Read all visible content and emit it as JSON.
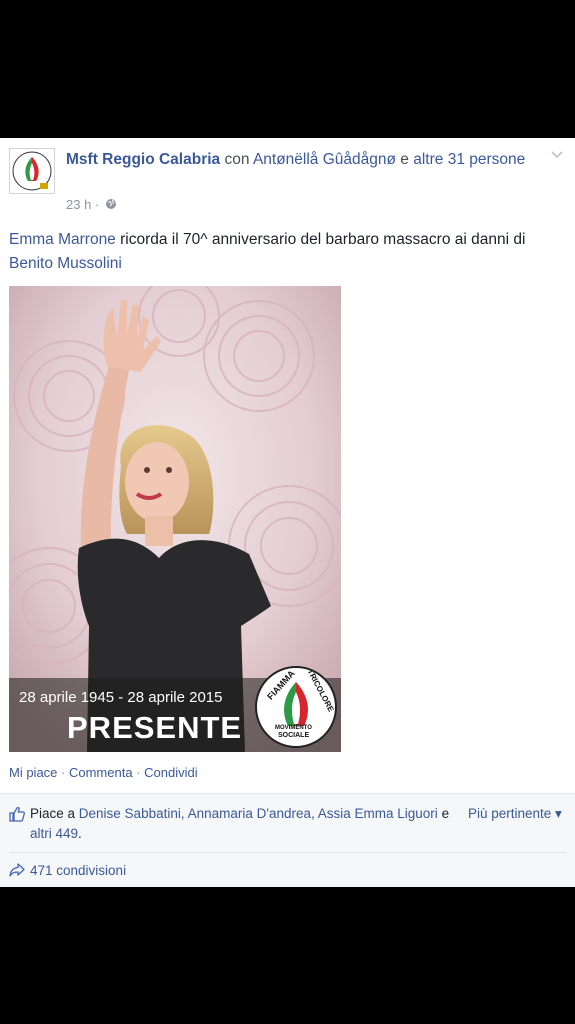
{
  "post": {
    "page_name": "Msft Reggio Calabria",
    "with_word": "con",
    "tagged_person": "Antønëllå Gûådågnø",
    "and_word": "e",
    "others": "altre 31 persone",
    "time": "23 h ·",
    "text_link_1": "Emma Marrone",
    "text_middle": " ricorda il 70^ anniversario del barbaro massacro ai danni di ",
    "text_link_2": "Benito Mussolini"
  },
  "photo": {
    "caption_dates": "28 aprile 1945 - 28 aprile 2015",
    "caption_title": "PRESENTE",
    "logo_top_left": "FIAMMA",
    "logo_top_right": "TRICOLORE",
    "logo_bottom_1": "MOVIMENTO",
    "logo_bottom_2": "SOCIALE"
  },
  "actions": {
    "like": "Mi piace",
    "comment": "Commenta",
    "share": "Condividi",
    "sep": " · "
  },
  "likes": {
    "prefix": "Piace a ",
    "names": "Denise Sabbatini, Annamaria D'andrea, Assia Emma Liguori",
    "and_word": " e ",
    "others": "altri 449",
    "suffix": ".",
    "sort_label": "Più pertinente ▾"
  },
  "shares": {
    "label": "471 condivisioni"
  },
  "icons": {
    "avatar": "page-logo-icon",
    "chevron": "chevron-down-icon",
    "globe": "globe-icon",
    "like": "thumbs-up-icon",
    "share": "share-arrow-icon"
  },
  "colors": {
    "link": "#3b5998",
    "meta": "#90949c",
    "background": "#000000"
  }
}
